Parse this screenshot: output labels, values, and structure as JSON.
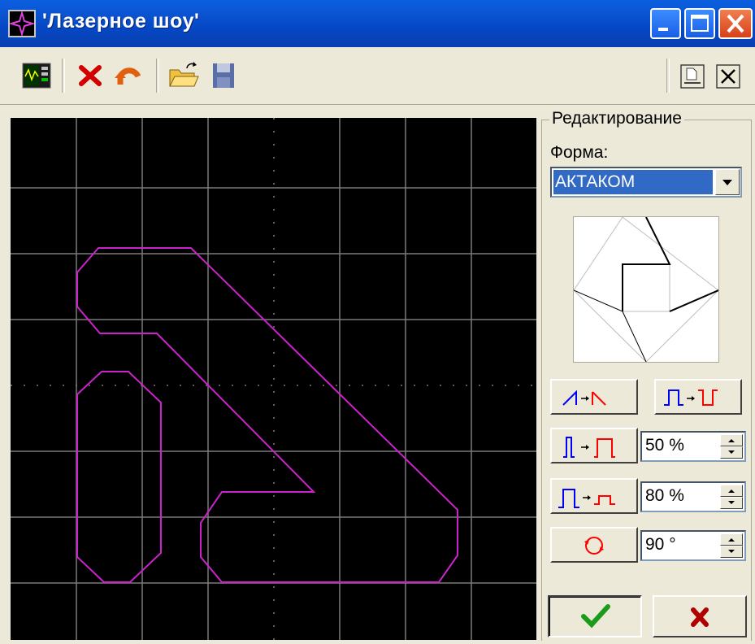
{
  "window": {
    "title": "'Лазерное шоу'"
  },
  "toolbar": {
    "buttons": [
      "oscilloscope-icon",
      "delete-icon",
      "undo-icon",
      "open-folder-icon",
      "save-icon"
    ],
    "right_buttons": [
      "print-preview-icon",
      "close-panel-icon"
    ]
  },
  "editor": {
    "group_title": "Редактирование",
    "shape_label": "Форма:",
    "shape_value": "АКТАКОМ",
    "spin1": "50 %",
    "spin2": "80 %",
    "spin3": "90 °"
  },
  "colors": {
    "trace": "#cc22cc",
    "grid": "#7a7a7a",
    "accent_blue": "#0000ff",
    "accent_red": "#ff0000",
    "ok_green": "#1a9c1a",
    "cancel_red": "#b00000"
  }
}
